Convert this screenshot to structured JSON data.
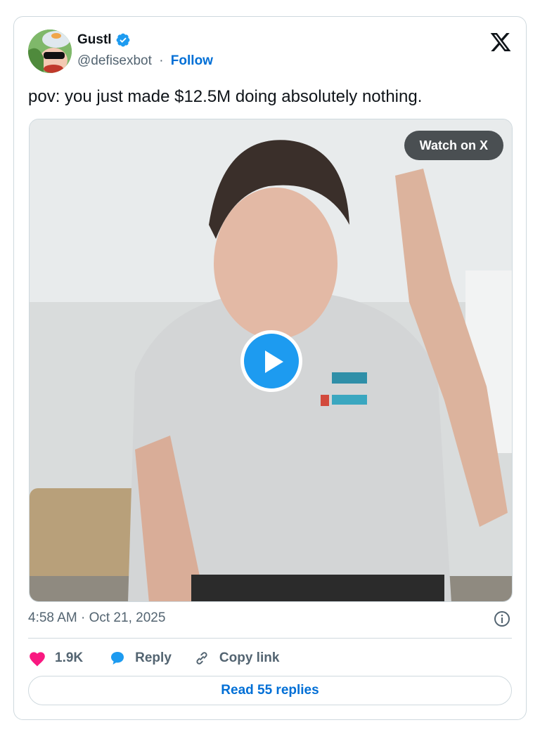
{
  "author": {
    "name": "Gustl",
    "handle": "@defisexbot",
    "separator": "·",
    "follow_label": "Follow"
  },
  "tweet": {
    "text": "pov: you just made $12.5M doing absolutely nothing."
  },
  "media": {
    "watch_label": "Watch on X"
  },
  "meta": {
    "timestamp": "4:58 AM · Oct 21, 2025"
  },
  "actions": {
    "like_count": "1.9K",
    "reply_label": "Reply",
    "copy_label": "Copy link"
  },
  "footer": {
    "read_replies_label": "Read 55 replies"
  },
  "icons": {
    "logo": "x-logo-icon",
    "verified": "verified-badge-icon",
    "play": "play-icon",
    "info": "info-icon",
    "like": "heart-icon",
    "reply": "speech-bubble-icon",
    "copy": "link-icon"
  },
  "colors": {
    "link_blue": "#006fd6",
    "verified_blue": "#1d9bf0",
    "like_pink": "#f91880",
    "muted_text": "#536471",
    "border": "#cfd9de"
  }
}
